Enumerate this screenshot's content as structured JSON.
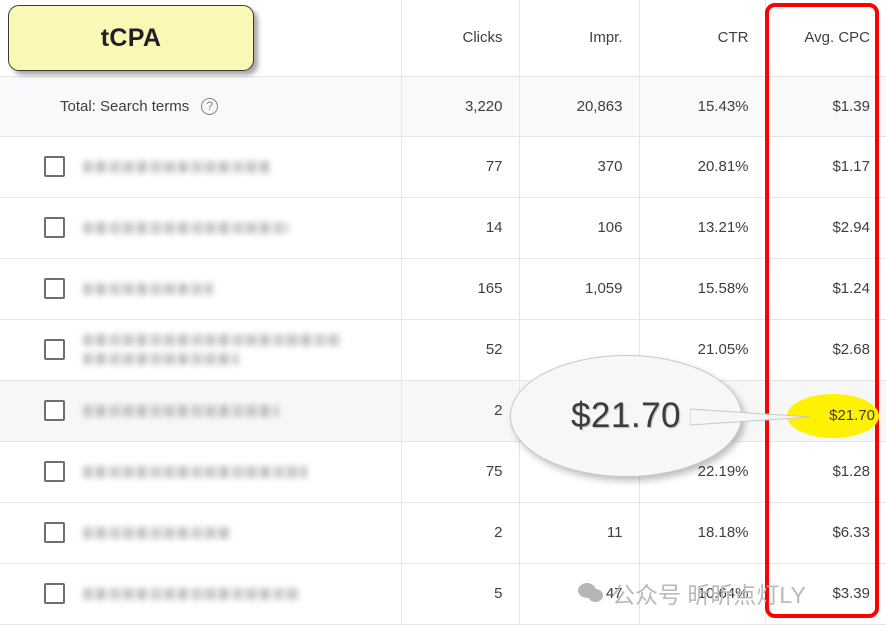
{
  "table": {
    "columns": [
      {
        "key": "term",
        "label": ""
      },
      {
        "key": "clicks",
        "label": "Clicks"
      },
      {
        "key": "impr",
        "label": "Impr."
      },
      {
        "key": "ctr",
        "label": "CTR"
      },
      {
        "key": "cpc",
        "label": "Avg. CPC"
      }
    ],
    "total_row": {
      "label": "Total: Search terms",
      "help_icon": "help-circle-icon",
      "help_glyph": "?",
      "clicks": "3,220",
      "impr": "20,863",
      "ctr": "15.43%",
      "cpc": "$1.39"
    },
    "rows": [
      {
        "term": "",
        "term_lines": 1,
        "clicks": "77",
        "impr": "370",
        "ctr": "20.81%",
        "cpc": "$1.17",
        "highlighted": false
      },
      {
        "term": "",
        "term_lines": 1,
        "clicks": "14",
        "impr": "106",
        "ctr": "13.21%",
        "cpc": "$2.94",
        "highlighted": false
      },
      {
        "term": "",
        "term_lines": 1,
        "clicks": "165",
        "impr": "1,059",
        "ctr": "15.58%",
        "cpc": "$1.24",
        "highlighted": false
      },
      {
        "term": "",
        "term_lines": 2,
        "clicks": "52",
        "impr": "",
        "ctr": "21.05%",
        "cpc": "$2.68",
        "highlighted": false
      },
      {
        "term": "",
        "term_lines": 1,
        "clicks": "2",
        "impr": "",
        "ctr": "",
        "cpc": "$21.70",
        "highlighted": true
      },
      {
        "term": "",
        "term_lines": 1,
        "clicks": "75",
        "impr": "",
        "ctr": "22.19%",
        "cpc": "$1.28",
        "highlighted": false
      },
      {
        "term": "",
        "term_lines": 1,
        "clicks": "2",
        "impr": "11",
        "ctr": "18.18%",
        "cpc": "$6.33",
        "highlighted": false
      },
      {
        "term": "",
        "term_lines": 1,
        "clicks": "5",
        "impr": "47",
        "ctr": "10.64%",
        "cpc": "$3.39",
        "highlighted": false
      }
    ]
  },
  "annotations": {
    "tcpa_label": "tCPA",
    "callout_value": "$21.70",
    "highlighted_cpc": "$21.70",
    "red_box_target": "Avg. CPC",
    "colors": {
      "tcpa_fill": "#fbf8b6",
      "red_box": "#ff0000",
      "yellow_highlight": "#fff200",
      "callout_fill": "#f7f7f7"
    }
  },
  "watermark": {
    "icon": "wechat-icon",
    "text": "公众号  昕昕点灯LY"
  }
}
